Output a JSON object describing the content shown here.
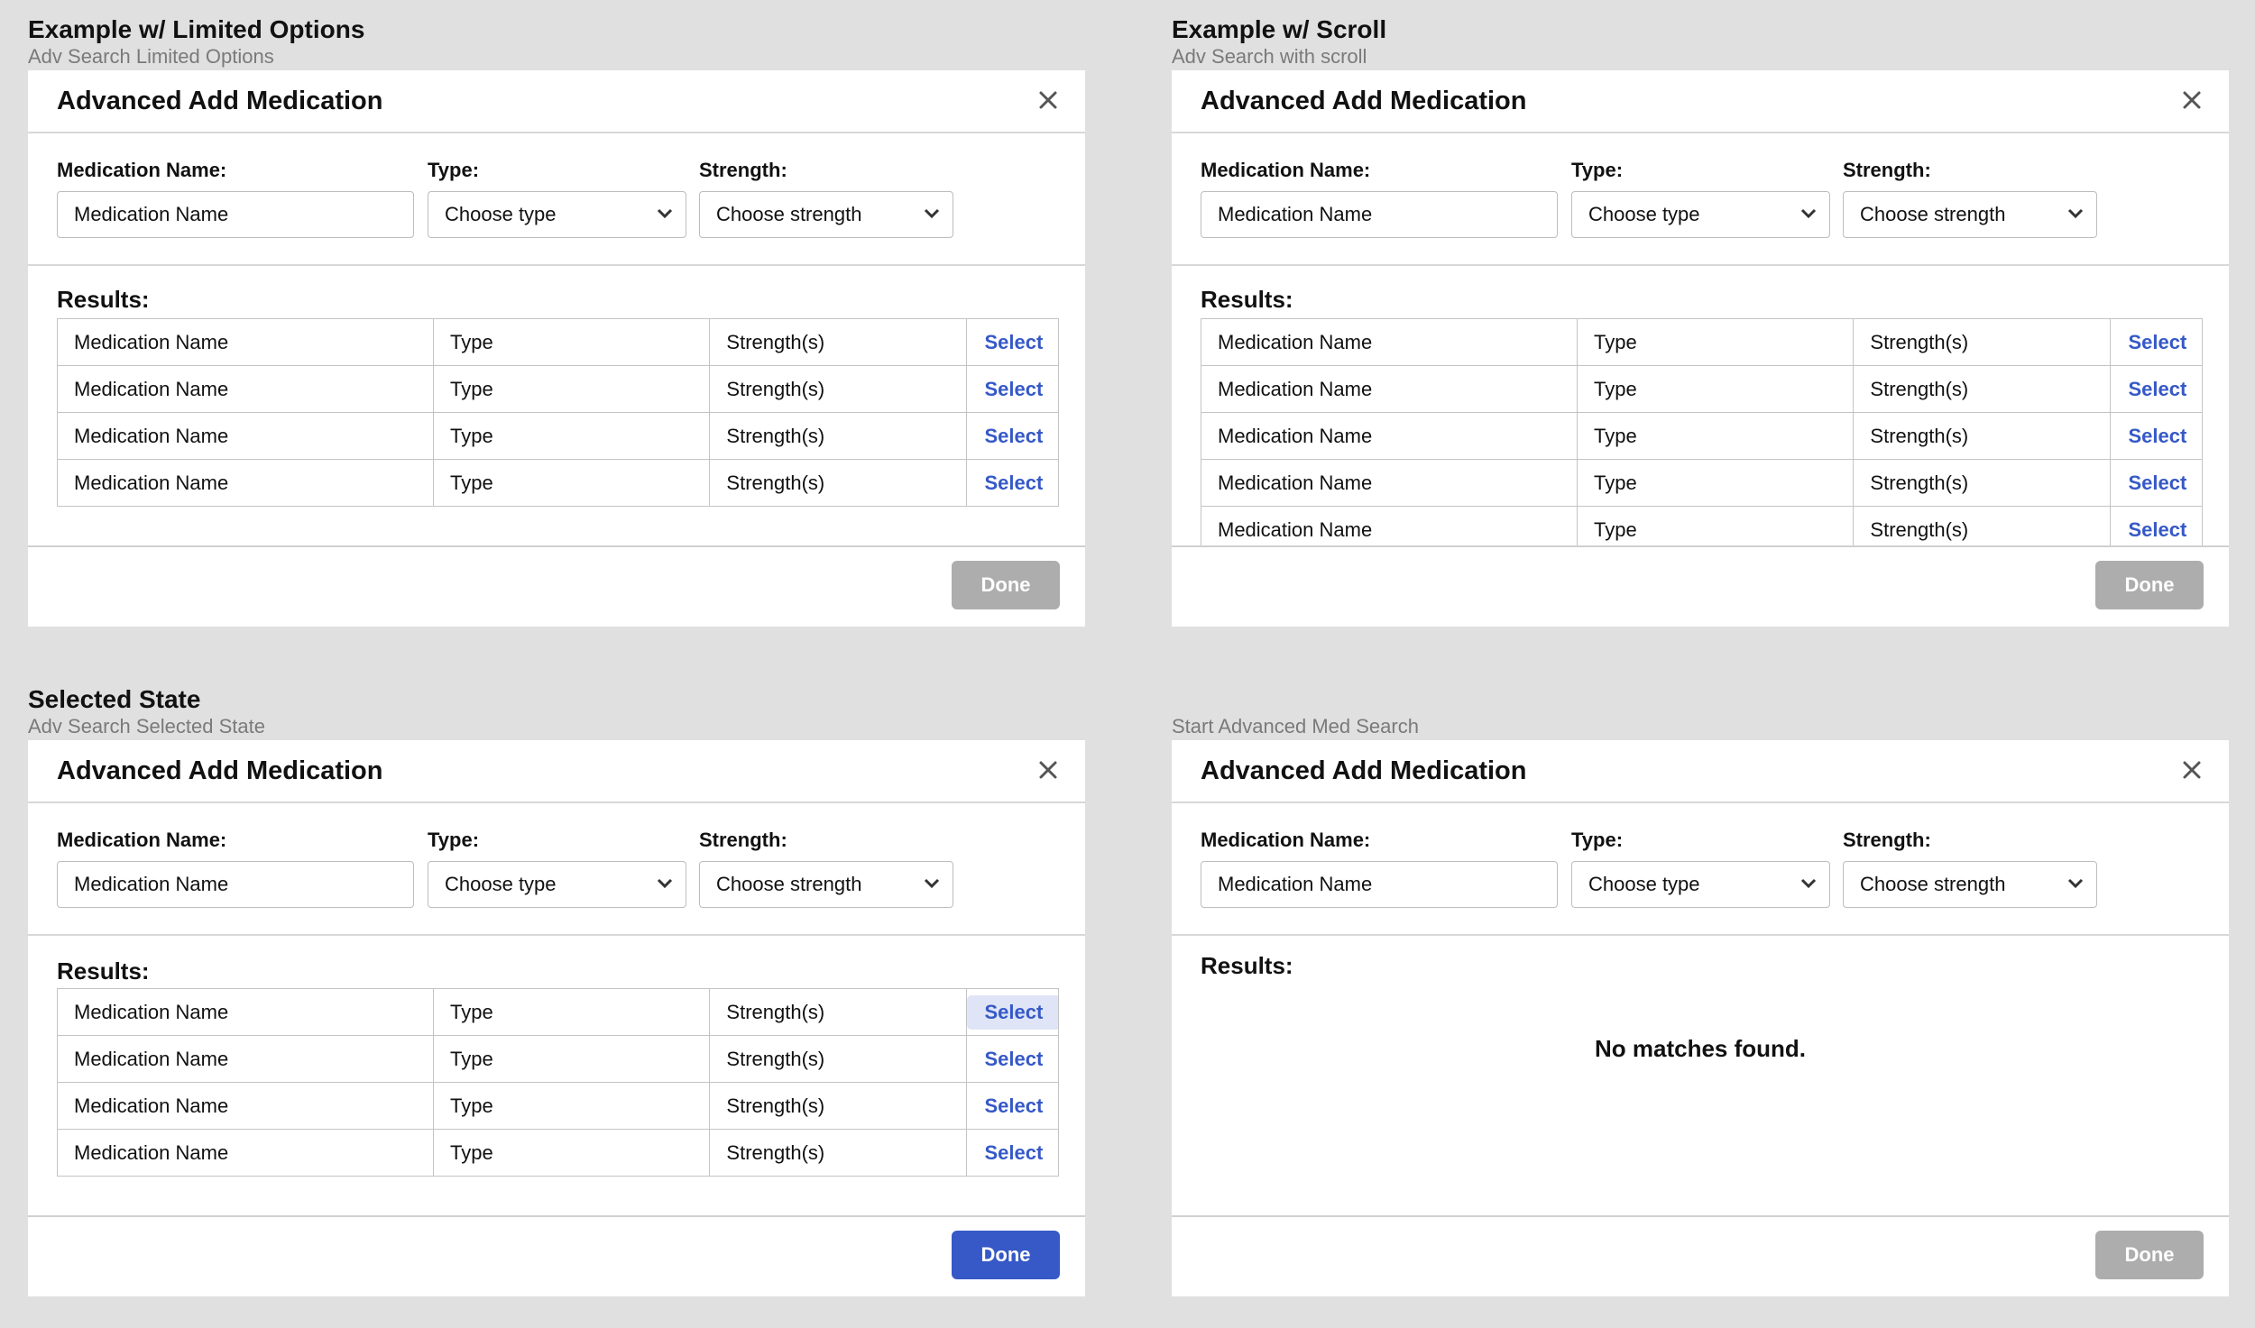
{
  "dialog_title": "Advanced Add Medication",
  "labels": {
    "medication_name": "Medication Name:",
    "type": "Type:",
    "strength": "Strength:",
    "results": "Results:"
  },
  "inputs": {
    "medication_name_value": "Medication Name",
    "type_value": "Choose type",
    "strength_value": "Choose strength"
  },
  "row": {
    "name": "Medication Name",
    "type": "Type",
    "strength": "Strength(s)",
    "select": "Select"
  },
  "done_label": "Done",
  "no_matches": "No matches found.",
  "panels": [
    {
      "title": "Example w/ Limited Options",
      "subtitle": "Adv Search Limited Options",
      "rows": 4,
      "done_state": "disabled"
    },
    {
      "title": "Example w/ Scroll",
      "subtitle": "Adv Search with scroll",
      "rows": 5,
      "done_state": "disabled"
    },
    {
      "title": "Selected State",
      "subtitle": "Adv Search Selected State",
      "rows": 4,
      "selected_row": 1,
      "done_state": "enabled"
    },
    {
      "title": "",
      "subtitle": "Start Advanced Med Search",
      "rows": 0,
      "done_state": "disabled"
    }
  ],
  "colors": {
    "accent": "#3659c7",
    "selected_bg": "#dfe5f6",
    "disabled": "#adadad",
    "page_bg": "#e0e0e0"
  },
  "icons": {
    "close": "close-icon",
    "dropdown": "chevron-down-icon"
  }
}
